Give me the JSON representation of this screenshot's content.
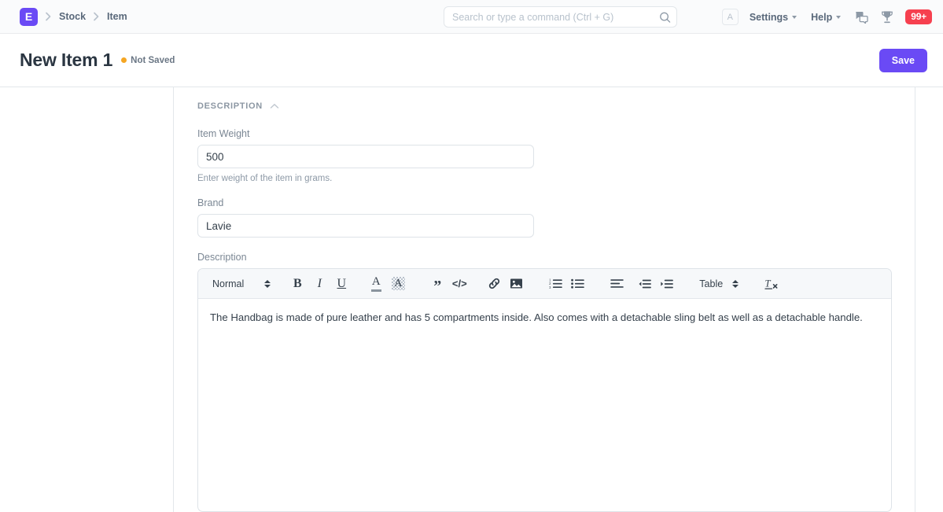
{
  "navbar": {
    "logo_letter": "E",
    "breadcrumbs": [
      {
        "label": "Stock"
      },
      {
        "label": "Item"
      }
    ],
    "search": {
      "placeholder": "Search or type a command (Ctrl + G)",
      "value": "",
      "icon": "search-icon"
    },
    "avatar_letter": "A",
    "links": [
      {
        "label": "Settings",
        "icon": "chevron-down-icon"
      },
      {
        "label": "Help",
        "icon": "chevron-down-icon"
      }
    ],
    "icons": [
      {
        "name": "chat-bubbles-icon"
      },
      {
        "name": "trophy-icon"
      }
    ],
    "notification_badge": "99+",
    "badge_color": "#f6404f",
    "brand_color": "#6a4af5"
  },
  "page_head": {
    "title": "New Item 1",
    "status_text": "Not Saved",
    "status_color": "#f5a623",
    "save_label": "Save"
  },
  "section": {
    "title": "DESCRIPTION",
    "collapse_icon": "chevron-up-icon"
  },
  "fields": {
    "item_weight": {
      "label": "Item Weight",
      "value": "500",
      "placeholder": "",
      "help": "Enter weight of the item in grams."
    },
    "brand": {
      "label": "Brand",
      "value": "Lavie",
      "placeholder": ""
    },
    "description": {
      "label": "Description",
      "content": "The Handbag is made of pure leather and has 5 compartments inside. Also comes with a detachable sling belt as well as a detachable handle."
    }
  },
  "editor_toolbar": {
    "style_select": {
      "label": "Normal",
      "icon": "updown-arrows-icon"
    },
    "table_select": {
      "label": "Table",
      "icon": "updown-arrows-icon"
    },
    "buttons": [
      {
        "name": "bold-icon",
        "glyph": "B"
      },
      {
        "name": "italic-icon",
        "glyph": "I"
      },
      {
        "name": "underline-icon",
        "glyph": "U"
      },
      {
        "name": "text-color-icon",
        "glyph": "A"
      },
      {
        "name": "background-color-icon",
        "glyph": "A"
      },
      {
        "name": "blockquote-icon",
        "glyph": "”"
      },
      {
        "name": "code-block-icon",
        "glyph": "</>"
      },
      {
        "name": "link-icon",
        "glyph": ""
      },
      {
        "name": "image-icon",
        "glyph": ""
      },
      {
        "name": "ordered-list-icon",
        "glyph": ""
      },
      {
        "name": "bullet-list-icon",
        "glyph": ""
      },
      {
        "name": "align-icon",
        "glyph": ""
      },
      {
        "name": "outdent-icon",
        "glyph": ""
      },
      {
        "name": "indent-icon",
        "glyph": ""
      },
      {
        "name": "clear-formatting-icon",
        "glyph": ""
      }
    ]
  }
}
